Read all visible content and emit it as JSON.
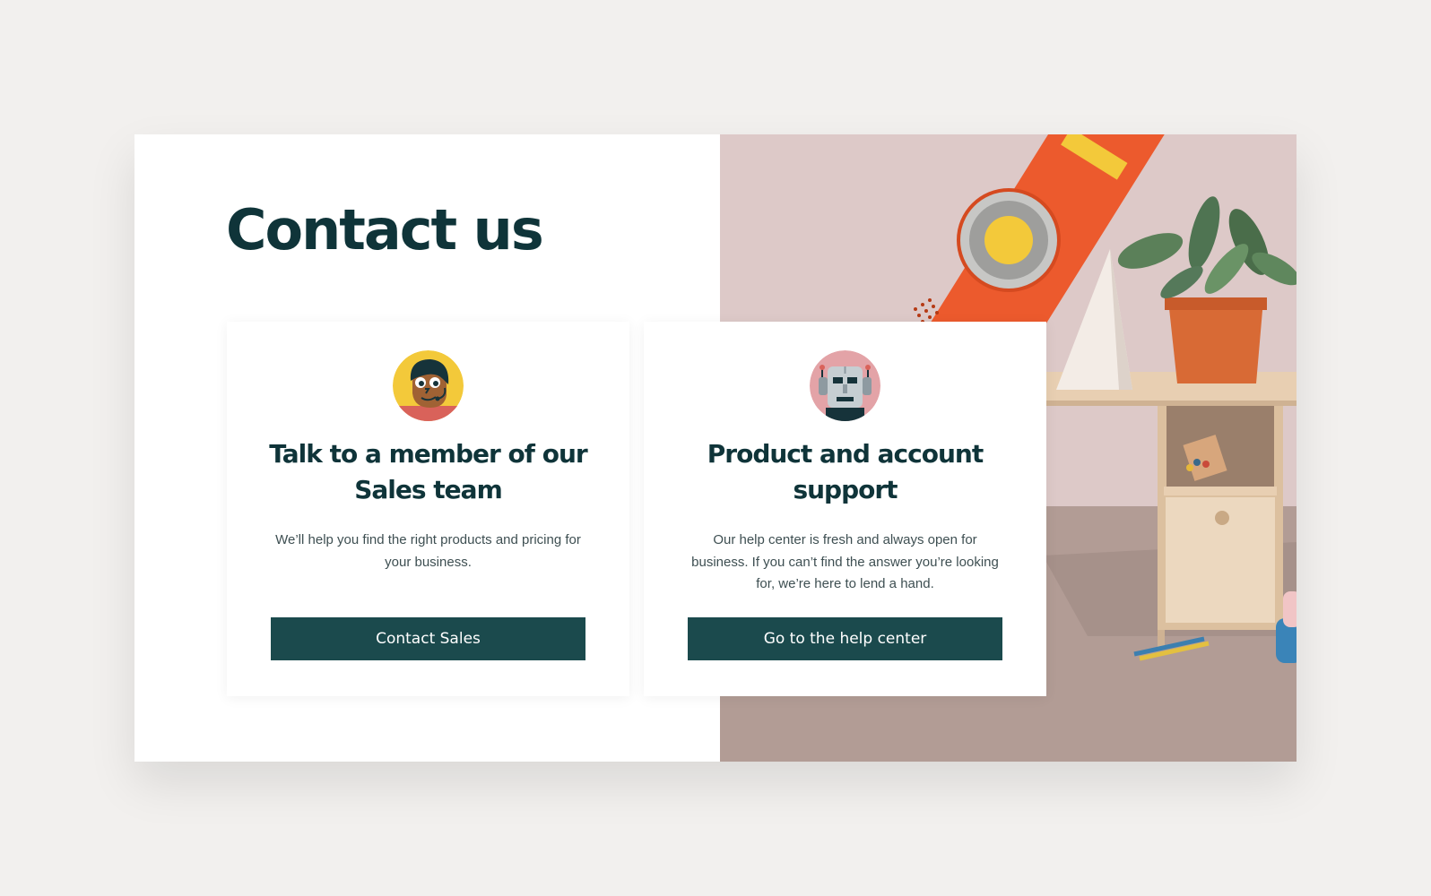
{
  "page": {
    "title": "Contact us"
  },
  "cards": [
    {
      "icon": "sales-agent-avatar-icon",
      "heading": "Talk to a member of our Sales team",
      "description": "We’ll help you find the right products and pricing for your business.",
      "button_label": "Contact Sales"
    },
    {
      "icon": "support-robot-avatar-icon",
      "heading": "Product and account support",
      "description": "Our help center is fresh and always open for business. If you can’t find the answer you’re looking for, we’re here to lend a hand.",
      "button_label": "Go to the help center"
    }
  ],
  "colors": {
    "page_background": "#f2f0ee",
    "heading_text": "#0f3439",
    "button_background": "#1b4a4d",
    "button_text": "#ffffff",
    "photo_accent_orange": "#ec5a2d",
    "photo_accent_yellow": "#f3c93a"
  }
}
